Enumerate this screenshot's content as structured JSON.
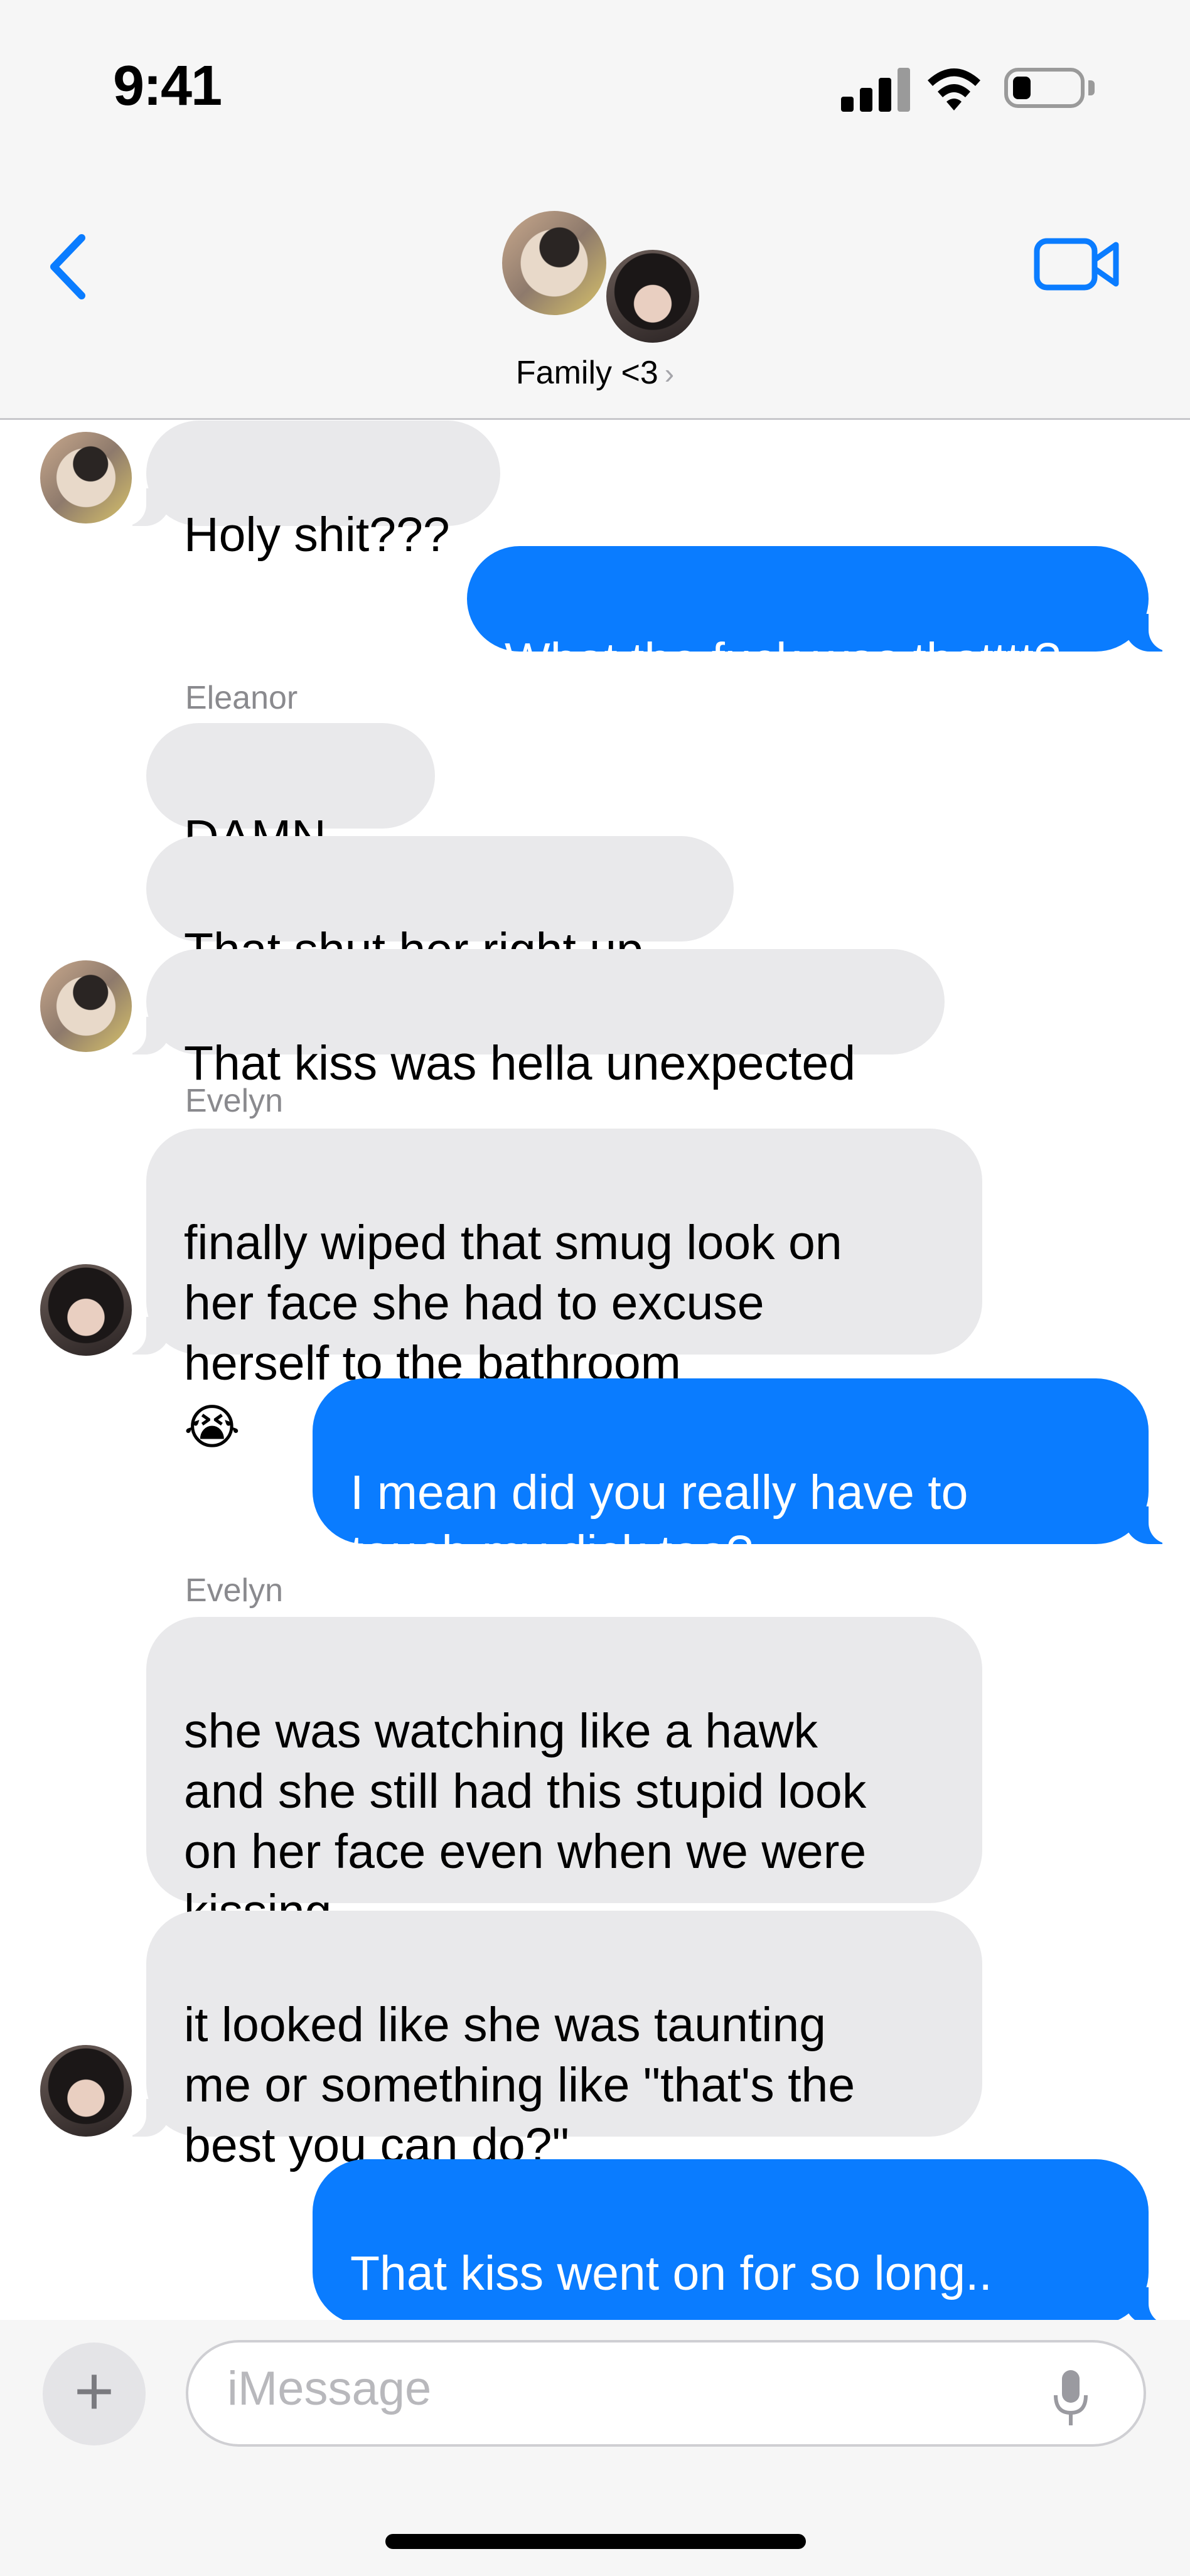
{
  "status_bar": {
    "time": "9:41"
  },
  "header": {
    "group_name": "Family <3",
    "chevron": "›"
  },
  "messages": [
    {
      "text": "Holy shit???"
    },
    {
      "text": "What the fuck was thatttt?"
    },
    {
      "sender": "Eleanor",
      "text": "DAMN",
      "emoji": "😩"
    },
    {
      "text": "That shut her right up"
    },
    {
      "text": "That kiss was hella unexpected"
    },
    {
      "sender": "Evelyn",
      "text": "finally wiped that smug look on\nher face she had to excuse\nherself to the bathroom",
      "emoji": "😭"
    },
    {
      "text": "I mean did you really have to\ntouch my dick too?"
    },
    {
      "sender": "Evelyn",
      "text": "she was watching like a hawk\nand she still had this stupid look\non her face even when we were\nkissing"
    },
    {
      "text": "it looked like she was taunting\nme or something like \"that's the\nbest you can do?\""
    },
    {
      "text": "That kiss went on for so long..",
      "emoji": "😮‍💨"
    }
  ],
  "composer": {
    "placeholder": "iMessage",
    "plus": "+"
  },
  "icons": [
    "back-chevron-icon",
    "video-camera-icon",
    "signal-icon",
    "wifi-icon",
    "battery-icon",
    "mic-icon"
  ],
  "colors": {
    "outgoing_bubble": "#0a7cff",
    "incoming_bubble": "#e9e9eb",
    "accent": "#0a7cff"
  }
}
